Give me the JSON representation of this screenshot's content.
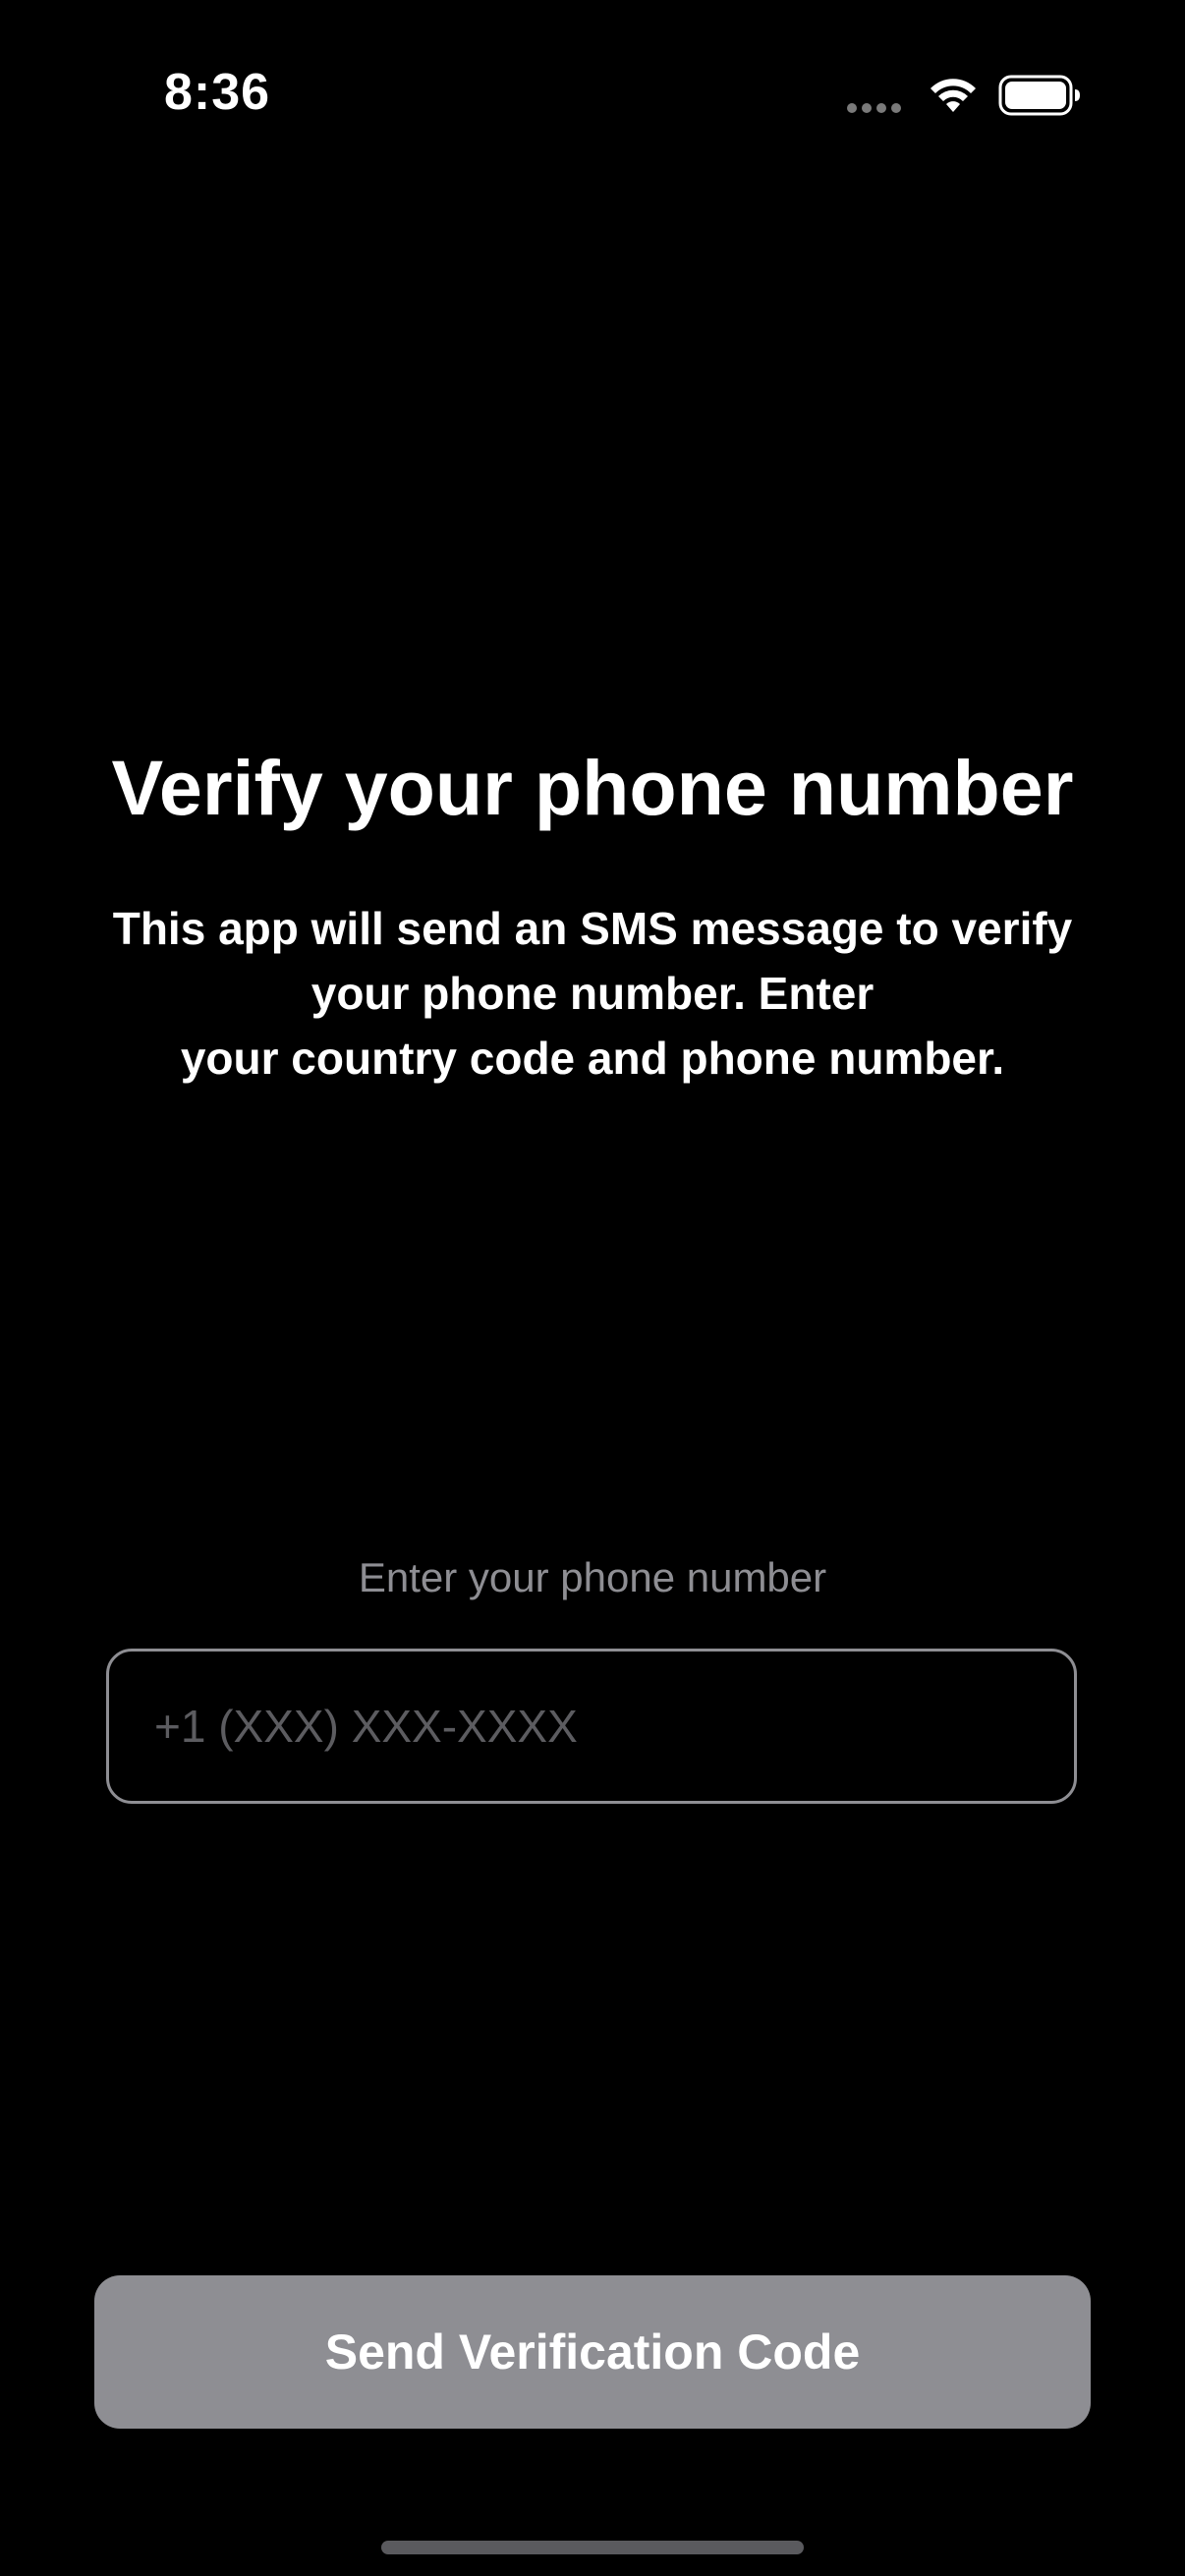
{
  "status_bar": {
    "time": "8:36",
    "icons": [
      "cellular-signal-icon",
      "wifi-icon",
      "battery-icon"
    ]
  },
  "header": {
    "title": "Verify your phone number",
    "description_lines": [
      "This app will send an SMS message to verify",
      "your phone number. Enter",
      "your country code and phone number."
    ]
  },
  "phone": {
    "label": "Enter your phone number",
    "value": "",
    "placeholder": "+1 (XXX) XXX-XXXX"
  },
  "actions": {
    "send_label": "Send Verification Code"
  },
  "colors": {
    "background": "#000000",
    "text_primary": "#ffffff",
    "text_secondary": "#8e8e93",
    "placeholder": "#5c5c60",
    "input_border": "#8e8e93",
    "button_disabled_bg": "#8e8e93"
  }
}
